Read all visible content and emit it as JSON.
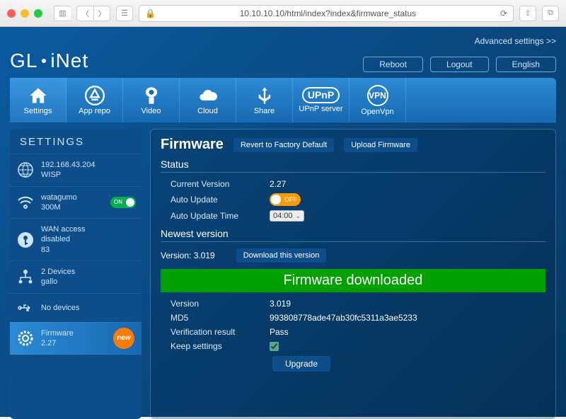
{
  "browser": {
    "url": "10.10.10.10/html/index?index&firmware_status"
  },
  "topbar": {
    "advanced": "Advanced settings >>"
  },
  "brand": {
    "part1": "GL",
    "part2": "iNet"
  },
  "header_buttons": {
    "reboot": "Reboot",
    "logout": "Logout",
    "english": "English"
  },
  "nav": [
    {
      "key": "settings",
      "label": "Settings"
    },
    {
      "key": "apprepo",
      "label": "App repo"
    },
    {
      "key": "video",
      "label": "Video"
    },
    {
      "key": "cloud",
      "label": "Cloud"
    },
    {
      "key": "share",
      "label": "Share"
    },
    {
      "key": "upnp",
      "label": "UPnP server",
      "badge": "UPnP"
    },
    {
      "key": "openvpn",
      "label": "OpenVpn",
      "badge": "VPN"
    }
  ],
  "sidebar": {
    "title": "SETTINGS",
    "items": [
      {
        "key": "wan-ip",
        "line1": "192.168.43.204",
        "line2": "WISP"
      },
      {
        "key": "wifi",
        "line1": "watagumo",
        "line2": "300M",
        "toggle": "ON"
      },
      {
        "key": "wan-access",
        "line1": "WAN access",
        "line2": "disabled",
        "line3": "83"
      },
      {
        "key": "clients",
        "line1": "2 Devices",
        "line2": "gallo"
      },
      {
        "key": "usb",
        "line1": "No devices",
        "line2": ""
      },
      {
        "key": "firmware",
        "line1": "Firmware",
        "line2": "2.27",
        "active": true,
        "badge": "new"
      }
    ]
  },
  "main": {
    "title": "Firmware",
    "revert_btn": "Revert to Factory Default",
    "upload_btn": "Upload Firmware",
    "status_head": "Status",
    "current_version_label": "Current Version",
    "current_version": "2.27",
    "auto_update_label": "Auto Update",
    "auto_update_toggle": "OFF",
    "auto_update_time_label": "Auto Update Time",
    "auto_update_time": "04:00",
    "newest_head": "Newest version",
    "newest_version_label": "Version:",
    "newest_version": "3.019",
    "download_btn": "Download this version",
    "banner": "Firmware downloaded",
    "dl_version_label": "Version",
    "dl_version": "3.019",
    "md5_label": "MD5",
    "md5": "993808778ade47ab30fc5311a3ae5233",
    "verify_label": "Verification result",
    "verify": "Pass",
    "keep_label": "Keep settings",
    "upgrade_btn": "Upgrade"
  },
  "colors": {
    "accent": "#1669b2",
    "banner": "#00a000",
    "new_badge": "#ff7a00",
    "off": "#ff9900",
    "on": "#00b050"
  }
}
